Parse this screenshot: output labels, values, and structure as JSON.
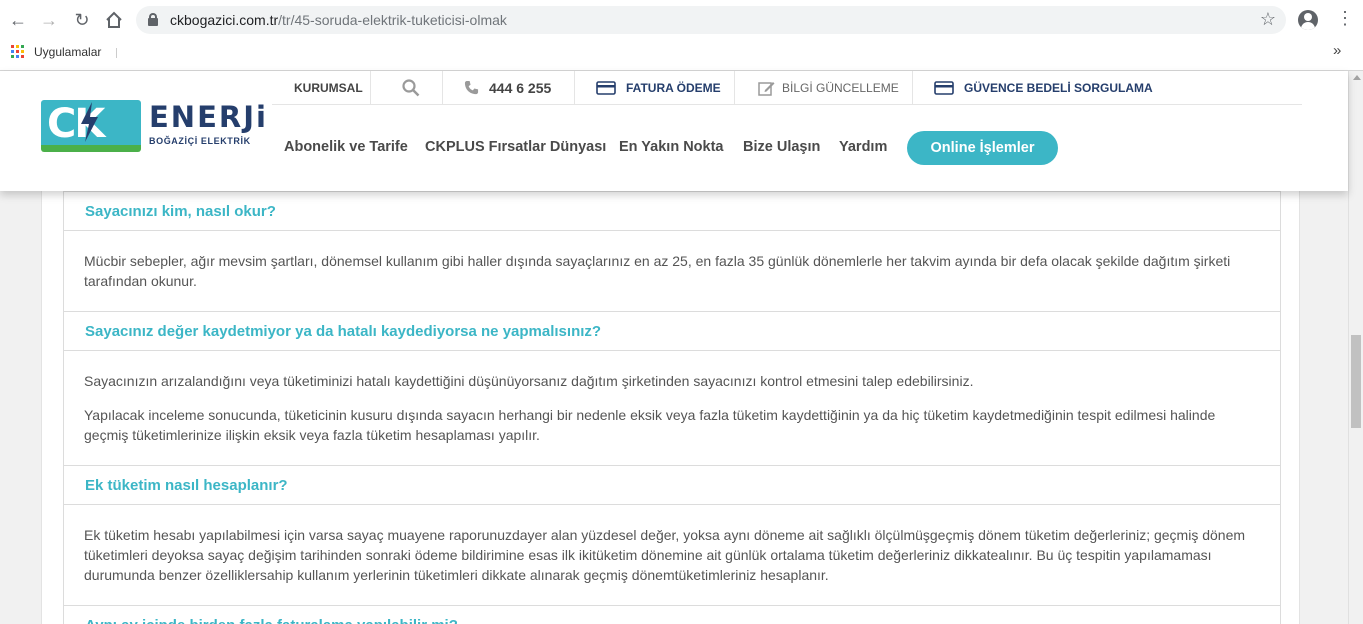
{
  "browser": {
    "url_domain": "ckbogazici.com.tr",
    "url_path": "/tr/45-soruda-elektrik-tuketicisi-olmak",
    "bookmarks_label": "Uygulamalar",
    "icons": [
      "back-icon",
      "forward-icon",
      "reload-icon",
      "home-icon",
      "lock-icon",
      "star-icon",
      "profile-icon",
      "menu-icon",
      "apps-icon"
    ]
  },
  "site": {
    "logo_ck": "CK",
    "logo_enerji": "ENERJi",
    "logo_sub": "BOĞAZİÇİ ELEKTRİK",
    "colors": {
      "teal": "#3cb6c6",
      "navy": "#253e6c",
      "green": "#4bb04a"
    },
    "topnav": {
      "kurumsal": "KURUMSAL",
      "phone": "444 6 255",
      "fatura": "FATURA ÖDEME",
      "bilgi": "BİLGİ GÜNCELLEME",
      "guvence": "GÜVENCE BEDELİ SORGULAMA"
    },
    "mainnav": {
      "abonelik": "Abonelik ve Tarife",
      "ckplus": "CKPLUS Fırsatlar Dünyası",
      "yakin": "En Yakın Nokta",
      "bize": "Bize Ulaşın",
      "yardim": "Yardım",
      "online": "Online İşlemler"
    }
  },
  "faq": [
    {
      "question": "Sayacınızı kim, nasıl okur?",
      "answer": [
        "Mücbir sebepler, ağır mevsim şartları, dönemsel kullanım gibi haller dışında sayaçlarınız en az 25, en fazla 35 günlük dönemlerle her takvim ayında bir defa olacak şekilde dağıtım şirketi tarafından okunur."
      ]
    },
    {
      "question": "Sayacınız değer kaydetmiyor ya da hatalı kaydediyorsa ne yapmalısınız?",
      "answer": [
        "Sayacınızın arızalandığını veya tüketiminizi hatalı kaydettiğini düşünüyorsanız dağıtım şirketinden sayacınızı kontrol etmesini talep edebilirsiniz.",
        "Yapılacak inceleme sonucunda, tüketicinin kusuru dışında sayacın herhangi bir nedenle eksik veya fazla tüketim kaydettiğinin ya da hiç tüketim kaydetmediğinin tespit edilmesi halinde geçmiş tüketimlerinize ilişkin eksik veya fazla tüketim hesaplaması yapılır."
      ]
    },
    {
      "question": "Ek tüketim nasıl hesaplanır?",
      "answer": [
        "Ek tüketim hesabı yapılabilmesi için varsa sayaç muayene raporunuzdayer alan yüzdesel değer, yoksa aynı döneme ait sağlıklı ölçülmüşgeçmiş dönem tüketim değerleriniz; geçmiş dönem tüketimleri deyoksa sayaç değişim tarihinden sonraki ödeme bildirimine esas ilk ikitüketim dönemine ait günlük ortalama tüketim değerleriniz dikkatealınır. Bu üç tespitin yapılamaması durumunda benzer özelliklersahip kullanım yerlerinin tüketimleri dikkate alınarak geçmiş dönemtüketimleriniz hesaplanır."
      ]
    },
    {
      "question": "Aynı ay içinde birden fazla faturalama yapılabilir mi?",
      "answer": []
    }
  ]
}
